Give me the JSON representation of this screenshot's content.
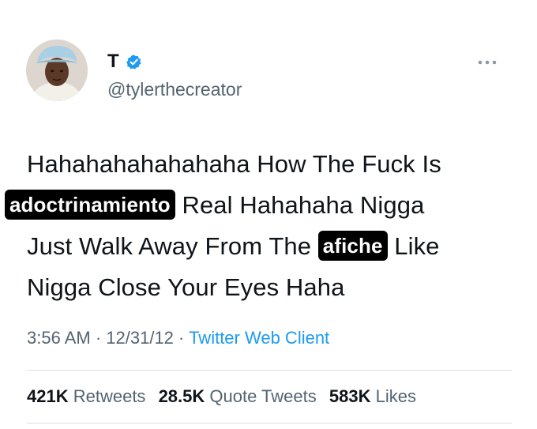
{
  "author": {
    "display_name": "T",
    "handle": "@tylerthecreator",
    "verified_icon": "verified-badge-icon",
    "avatar_icon": "avatar-photo"
  },
  "tweet": {
    "line1": "Hahahahahahahaha How The Fuck Is",
    "redact1": "adoctrinamiento",
    "line2_rest": " Real Hahahaha Nigga",
    "line3_start": "Just Walk Away From The ",
    "redact2": "afiche",
    "line3_end": " Like",
    "line4": "Nigga Close Your Eyes Haha"
  },
  "meta": {
    "time": "3:56 AM",
    "sep1": " · ",
    "date": "12/31/12",
    "sep2": " · ",
    "source": "Twitter Web Client"
  },
  "stats": {
    "retweets_count": "421K",
    "retweets_label": "Retweets",
    "quotes_count": "28.5K",
    "quotes_label": "Quote Tweets",
    "likes_count": "583K",
    "likes_label": "Likes"
  },
  "colors": {
    "text": "#0f1419",
    "secondary": "#536471",
    "link": "#1d9bf0",
    "verified": "#1d9bf0",
    "redaction_bg": "#000000"
  }
}
